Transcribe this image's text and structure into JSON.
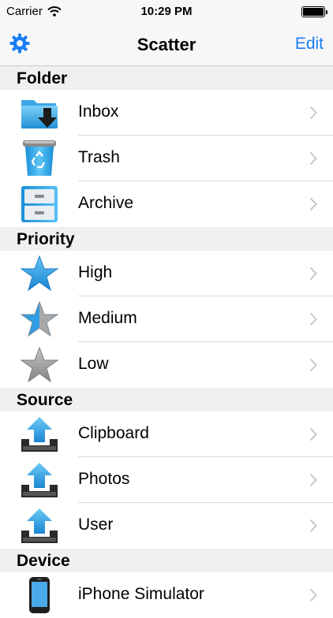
{
  "status_bar": {
    "carrier": "Carrier",
    "time": "10:29 PM"
  },
  "nav": {
    "title": "Scatter",
    "edit_label": "Edit",
    "settings_icon": "gear-icon"
  },
  "sections": [
    {
      "header": "Folder",
      "rows": [
        {
          "label": "Inbox",
          "icon": "inbox-folder-icon"
        },
        {
          "label": "Trash",
          "icon": "recycle-bin-icon"
        },
        {
          "label": "Archive",
          "icon": "filing-cabinet-icon"
        }
      ]
    },
    {
      "header": "Priority",
      "rows": [
        {
          "label": "High",
          "icon": "star-full-icon"
        },
        {
          "label": "Medium",
          "icon": "star-half-icon"
        },
        {
          "label": "Low",
          "icon": "star-empty-icon"
        }
      ]
    },
    {
      "header": "Source",
      "rows": [
        {
          "label": "Clipboard",
          "icon": "upload-tray-icon"
        },
        {
          "label": "Photos",
          "icon": "upload-tray-icon"
        },
        {
          "label": "User",
          "icon": "upload-tray-icon"
        }
      ]
    },
    {
      "header": "Device",
      "rows": [
        {
          "label": "iPhone Simulator",
          "icon": "iphone-icon"
        }
      ]
    }
  ],
  "colors": {
    "accent": "#1a7ef5",
    "star_blue": "#2f9de3",
    "star_gray": "#9a9a9a",
    "section_bg": "#f0f0f2"
  }
}
